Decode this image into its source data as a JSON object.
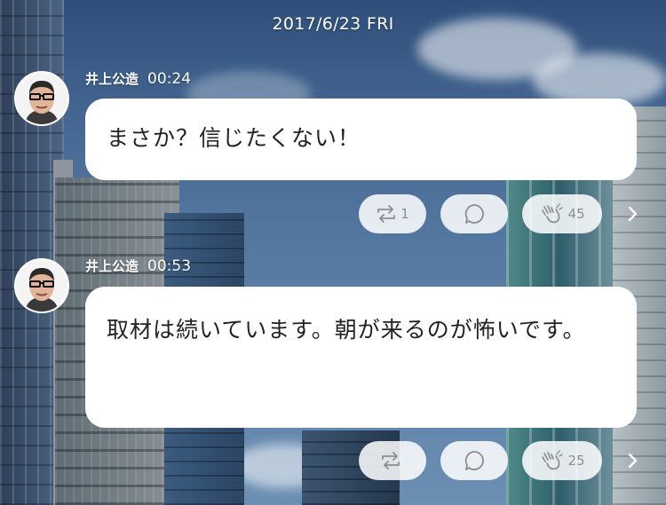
{
  "header": {
    "date": "2017/6/23 FRI"
  },
  "posts": [
    {
      "author": "井上公造",
      "time": "00:24",
      "text": "まさか？信じたくない！",
      "repost_count": "1",
      "clap_count": "45"
    },
    {
      "author": "井上公造",
      "time": "00:53",
      "text": "取材は続いています。朝が来るのが怖いです。",
      "repost_count": "",
      "clap_count": "25"
    }
  ],
  "icons": {
    "repost": "repost-icon",
    "comment": "comment-icon",
    "clap": "clap-icon",
    "more": "chevron-right-icon"
  },
  "colors": {
    "bubble": "#ffffff",
    "action_pill": "#ffffff",
    "action_text": "#8e8e8e",
    "text": "#222222"
  }
}
